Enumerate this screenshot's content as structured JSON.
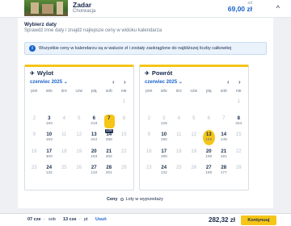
{
  "header": {
    "city": "Zadar",
    "subtitle": "Chorwacja",
    "price_label": "od",
    "price": "69,00 zł",
    "chevron": "^"
  },
  "panel": {
    "title": "Wybierz daty",
    "subtitle": "Sprawdź inne daty i znajdź najlepsze ceny w widoku kalendarza",
    "info": "Wszystkie ceny w kalendarzu są w walucie zł i zostały zaokrąglone do najbliższej liczby całkowitej"
  },
  "outbound": {
    "title": "Wylot",
    "month": "czerwiec 2025",
    "dow": [
      "pon",
      "wto",
      "śro",
      "czw",
      "pią",
      "sob",
      "nie"
    ],
    "days": [
      {
        "n": "",
        "p": "",
        "cls": "empty"
      },
      {
        "n": "",
        "p": "",
        "cls": "empty"
      },
      {
        "n": "",
        "p": "",
        "cls": "empty"
      },
      {
        "n": "",
        "p": "",
        "cls": "empty"
      },
      {
        "n": "",
        "p": "",
        "cls": "empty"
      },
      {
        "n": "",
        "p": "",
        "cls": "empty"
      },
      {
        "n": "1",
        "p": "",
        "cls": "dis"
      },
      {
        "n": "2",
        "p": "",
        "cls": "dis"
      },
      {
        "n": "3",
        "p": "193",
        "cls": ""
      },
      {
        "n": "4",
        "p": "",
        "cls": "dis"
      },
      {
        "n": "5",
        "p": "",
        "cls": "dis"
      },
      {
        "n": "6",
        "p": "219",
        "cls": ""
      },
      {
        "n": "7",
        "p": "128",
        "cls": "sel"
      },
      {
        "n": "8",
        "p": "",
        "cls": "dis"
      },
      {
        "n": "9",
        "p": "",
        "cls": "dis"
      },
      {
        "n": "10",
        "p": "193",
        "cls": ""
      },
      {
        "n": "11",
        "p": "",
        "cls": "dis"
      },
      {
        "n": "12",
        "p": "",
        "cls": "dis"
      },
      {
        "n": "13",
        "p": "242",
        "cls": ""
      },
      {
        "n": "14",
        "p": "288",
        "cls": ""
      },
      {
        "n": "15",
        "p": "",
        "cls": "dis"
      },
      {
        "n": "16",
        "p": "",
        "cls": "dis"
      },
      {
        "n": "17",
        "p": "300",
        "cls": ""
      },
      {
        "n": "18",
        "p": "",
        "cls": "dis"
      },
      {
        "n": "19",
        "p": "",
        "cls": "dis"
      },
      {
        "n": "20",
        "p": "193",
        "cls": ""
      },
      {
        "n": "21",
        "p": "292",
        "cls": ""
      },
      {
        "n": "22",
        "p": "",
        "cls": "dis"
      },
      {
        "n": "23",
        "p": "",
        "cls": "dis"
      },
      {
        "n": "24",
        "p": "132",
        "cls": ""
      },
      {
        "n": "25",
        "p": "",
        "cls": "dis"
      },
      {
        "n": "26",
        "p": "",
        "cls": "dis"
      },
      {
        "n": "27",
        "p": "132",
        "cls": ""
      },
      {
        "n": "28",
        "p": "261",
        "cls": ""
      },
      {
        "n": "29",
        "p": "",
        "cls": "dis"
      }
    ]
  },
  "inbound": {
    "title": "Powrót",
    "month": "czerwiec 2025",
    "dow": [
      "pon",
      "wto",
      "śro",
      "czw",
      "pią",
      "sob",
      "nie"
    ],
    "days": [
      {
        "n": "",
        "p": "",
        "cls": "empty"
      },
      {
        "n": "",
        "p": "",
        "cls": "empty"
      },
      {
        "n": "",
        "p": "",
        "cls": "empty"
      },
      {
        "n": "",
        "p": "",
        "cls": "empty"
      },
      {
        "n": "",
        "p": "",
        "cls": "empty"
      },
      {
        "n": "",
        "p": "",
        "cls": "empty"
      },
      {
        "n": "1",
        "p": "",
        "cls": "dis"
      },
      {
        "n": "2",
        "p": "",
        "cls": "dis"
      },
      {
        "n": "3",
        "p": "125",
        "cls": "dis"
      },
      {
        "n": "4",
        "p": "",
        "cls": "dis"
      },
      {
        "n": "5",
        "p": "",
        "cls": "dis"
      },
      {
        "n": "6",
        "p": "",
        "cls": "dis"
      },
      {
        "n": "7",
        "p": "",
        "cls": "dis"
      },
      {
        "n": "8",
        "p": "344",
        "cls": ""
      },
      {
        "n": "9",
        "p": "",
        "cls": "dis"
      },
      {
        "n": "10",
        "p": "190",
        "cls": ""
      },
      {
        "n": "11",
        "p": "",
        "cls": "dis"
      },
      {
        "n": "12",
        "p": "",
        "cls": "dis"
      },
      {
        "n": "13",
        "p": "155",
        "cls": "circ"
      },
      {
        "n": "14",
        "p": "149",
        "cls": ""
      },
      {
        "n": "15",
        "p": "",
        "cls": "dis"
      },
      {
        "n": "16",
        "p": "",
        "cls": "dis"
      },
      {
        "n": "17",
        "p": "190",
        "cls": ""
      },
      {
        "n": "18",
        "p": "",
        "cls": "dis"
      },
      {
        "n": "19",
        "p": "",
        "cls": "dis"
      },
      {
        "n": "20",
        "p": "190",
        "cls": ""
      },
      {
        "n": "21",
        "p": "181",
        "cls": ""
      },
      {
        "n": "22",
        "p": "",
        "cls": "dis"
      },
      {
        "n": "23",
        "p": "",
        "cls": "dis"
      },
      {
        "n": "24",
        "p": "132",
        "cls": ""
      },
      {
        "n": "25",
        "p": "",
        "cls": "dis"
      },
      {
        "n": "26",
        "p": "",
        "cls": "dis"
      },
      {
        "n": "27",
        "p": "190",
        "cls": ""
      },
      {
        "n": "28",
        "p": "177",
        "cls": ""
      },
      {
        "n": "29",
        "p": "",
        "cls": "dis"
      }
    ]
  },
  "legend": {
    "label": "Ceny",
    "option": "Loty w wyprzedaży"
  },
  "bottom": {
    "out_date": "07 cze",
    "sep1": "·",
    "out_day": "sob",
    "in_date": "13 cze",
    "sep2": "·",
    "in_day": "pt",
    "remove": "Usuń",
    "total": "282,32 zł",
    "continue": "Kontynuuj"
  },
  "colors": {
    "accent": "#f5c518",
    "navy": "#1a2b4c",
    "link": "#1a63c9"
  }
}
